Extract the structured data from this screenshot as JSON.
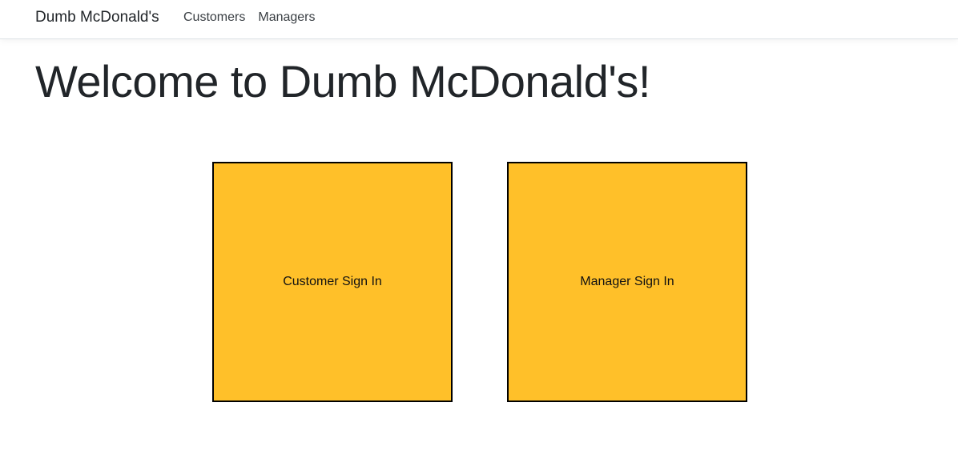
{
  "navbar": {
    "brand": "Dumb McDonald's",
    "links": [
      {
        "label": "Customers"
      },
      {
        "label": "Managers"
      }
    ]
  },
  "main": {
    "title": "Welcome to Dumb McDonald's!",
    "cards": [
      {
        "label": "Customer Sign In"
      },
      {
        "label": "Manager Sign In"
      }
    ]
  },
  "colors": {
    "card_background": "#ffc029",
    "card_border": "#000000",
    "text": "#212529"
  }
}
